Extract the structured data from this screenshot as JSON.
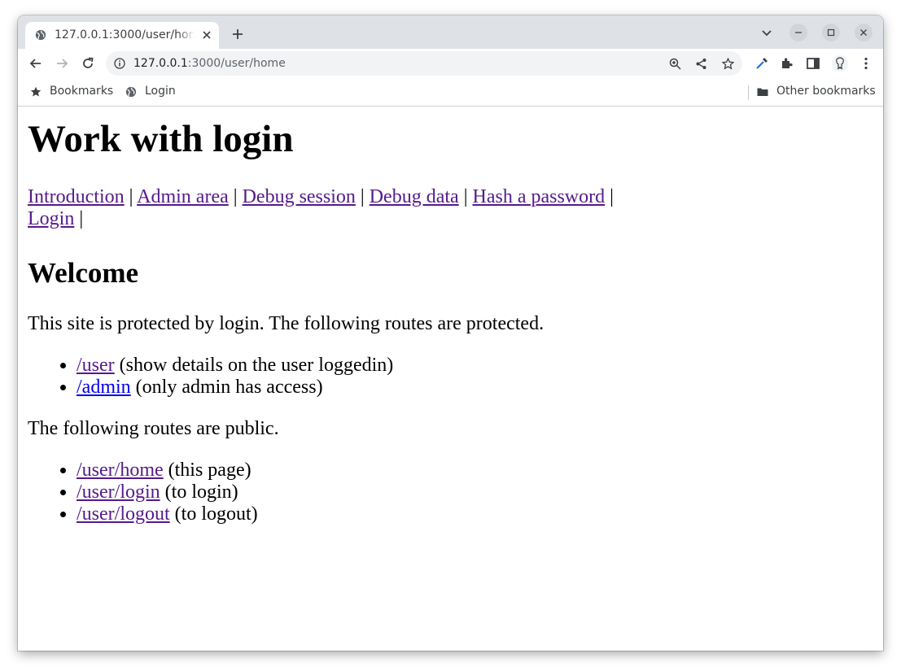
{
  "browser": {
    "tab_title": "127.0.0.1:3000/user/home",
    "url_host": "127.0.0.1",
    "url_rest": ":3000/user/home",
    "bookmarks": [
      {
        "label": "Bookmarks",
        "icon": "star-icon"
      },
      {
        "label": "Login",
        "icon": "globe-icon"
      }
    ],
    "other_bookmarks": "Other bookmarks"
  },
  "page": {
    "title": "Work with login",
    "nav": [
      {
        "label": "Introduction"
      },
      {
        "label": "Admin area"
      },
      {
        "label": "Debug session"
      },
      {
        "label": "Debug data"
      },
      {
        "label": "Hash a password"
      },
      {
        "label": "Login"
      }
    ],
    "nav_separator": "|",
    "welcome_heading": "Welcome",
    "protected_intro": "This site is protected by login. The following routes are protected.",
    "protected_routes": [
      {
        "link": "/user",
        "desc": " (show details on the user loggedin)"
      },
      {
        "link": "/admin",
        "desc": " (only admin has access)"
      }
    ],
    "public_intro": "The following routes are public.",
    "public_routes": [
      {
        "link": "/user/home",
        "desc": " (this page)"
      },
      {
        "link": "/user/login",
        "desc": " (to login)"
      },
      {
        "link": "/user/logout",
        "desc": " (to logout)"
      }
    ]
  }
}
